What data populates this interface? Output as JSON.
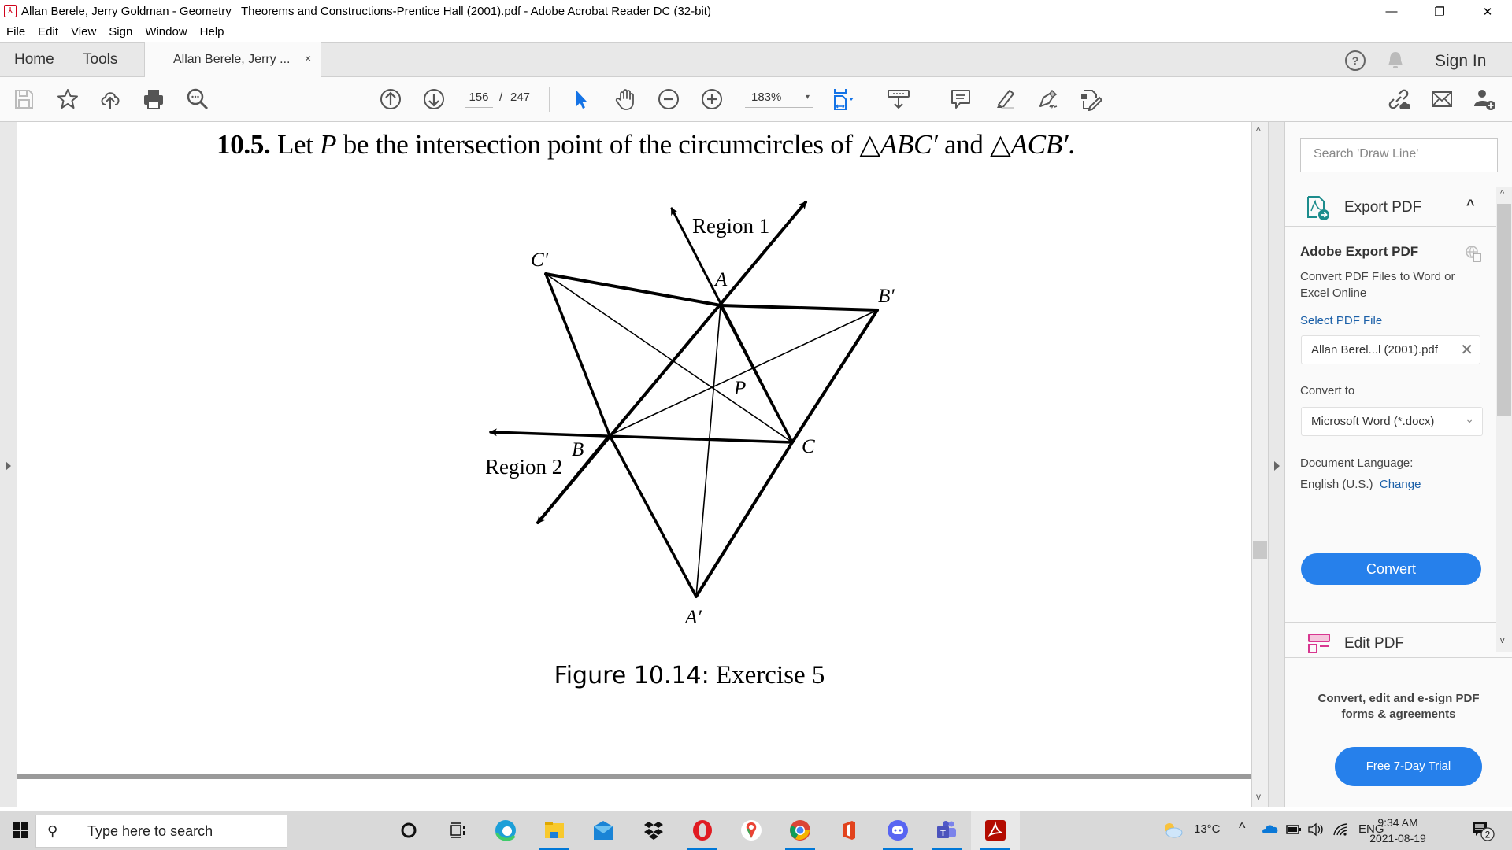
{
  "window": {
    "title": "Allan Berele, Jerry Goldman - Geometry_ Theorems and Constructions-Prentice Hall (2001).pdf - Adobe Acrobat Reader DC (32-bit)",
    "app_icon": "acrobat-icon",
    "controls": {
      "minimize": "—",
      "restore": "❐",
      "close": "✕"
    }
  },
  "menu": [
    "File",
    "Edit",
    "View",
    "Sign",
    "Window",
    "Help"
  ],
  "tabs": {
    "home": "Home",
    "tools": "Tools",
    "document": "Allan Berele, Jerry ...",
    "document_close": "×",
    "sign_in": "Sign In"
  },
  "toolbar": {
    "left_icons": [
      "save-icon",
      "bookmark-star-icon",
      "upload-cloud-icon",
      "print-icon",
      "find-zoom-icon"
    ],
    "page_current": "156",
    "page_separator": "/",
    "page_total": "247",
    "zoom_level": "183%",
    "zoom_caret": "▾",
    "tools": [
      "prev-page-icon",
      "next-page-icon",
      "select-cursor-icon",
      "hand-icon",
      "zoom-out-icon",
      "zoom-in-icon",
      "fit-page-icon",
      "scroll-mode-icon",
      "comment-icon",
      "highlight-icon",
      "sign-icon",
      "fill-sign-icon"
    ],
    "right_icons": [
      "share-link-icon",
      "email-icon",
      "add-user-icon"
    ]
  },
  "document": {
    "problem_number": "10.5.",
    "problem_text_1": "Let ",
    "problem_var_p": "P",
    "problem_text_2": " be the intersection point of the circumcircles of ",
    "triangle_1": "△ABC′",
    "problem_text_3": " and ",
    "triangle_2": "△ACB′",
    "problem_text_4": ".",
    "figure": {
      "labels": {
        "region1": "Region 1",
        "region2": "Region 2",
        "A": "A",
        "B": "B",
        "C": "C",
        "A_prime": "A′",
        "B_prime": "B′",
        "C_prime": "C′",
        "P": "P"
      }
    },
    "caption_prefix": "Figure 10.14:",
    "caption_text": " Exercise 5"
  },
  "right_panel": {
    "search_placeholder": "Search 'Draw Line'",
    "export_header": "Export PDF",
    "export_collapse": "^",
    "export_title": "Adobe Export PDF",
    "export_desc": "Convert PDF Files to Word or Excel Online",
    "select_file_label": "Select PDF File",
    "selected_file": "Allan Berel...l (2001).pdf",
    "clear_file": "✕",
    "convert_to_label": "Convert to",
    "convert_format": "Microsoft Word (*.docx)",
    "doc_language_label": "Document Language:",
    "doc_language_value": "English (U.S.)",
    "change_link": "Change",
    "convert_button": "Convert",
    "next_tool": "Edit PDF",
    "promo_text": "Convert, edit and e-sign PDF forms & agreements",
    "trial_button": "Free 7-Day Trial"
  },
  "taskbar": {
    "search_placeholder": "Type here to search",
    "apps": [
      "cortana",
      "task-view",
      "edge",
      "file-explorer",
      "mail",
      "dropbox",
      "opera",
      "google-maps",
      "chrome",
      "office",
      "discord",
      "teams",
      "acrobat"
    ],
    "weather": "13°C",
    "language": "ENG",
    "time": "9:34 AM",
    "date": "2021-08-19",
    "notification_count": "2"
  },
  "colors": {
    "accent_blue": "#2680eb",
    "link_blue": "#1a5fa8",
    "acrobat_red": "#d0021b",
    "export_teal": "#1c8c8c",
    "edit_pink": "#d83790"
  }
}
